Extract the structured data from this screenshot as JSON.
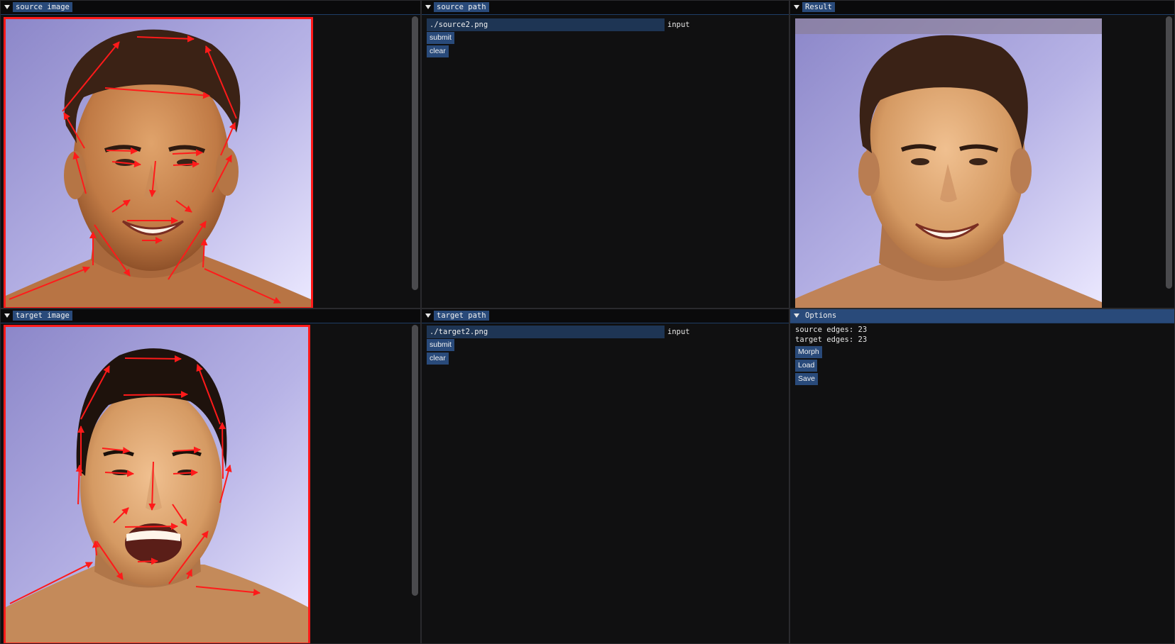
{
  "panels": {
    "source_image": {
      "title": "source image"
    },
    "source_path": {
      "title": "source path",
      "input_value": "./source2.png",
      "input_label": "input",
      "submit_label": "submit",
      "clear_label": "clear"
    },
    "result": {
      "title": "Result"
    },
    "target_image": {
      "title": "target image"
    },
    "target_path": {
      "title": "target path",
      "input_value": "./target2.png",
      "input_label": "input",
      "submit_label": "submit",
      "clear_label": "clear"
    },
    "options": {
      "title": "Options",
      "source_edges": "source edges: 23",
      "target_edges": "target edges: 23",
      "morph_label": "Morph",
      "load_label": "Load",
      "save_label": "Save"
    }
  },
  "colors": {
    "accent": "#294a7a",
    "edge_arrow": "#ff1a1a",
    "image_border": "#ff1a1a",
    "background": "#0f0f10"
  },
  "icons": {
    "collapse": "triangle-down-icon"
  }
}
